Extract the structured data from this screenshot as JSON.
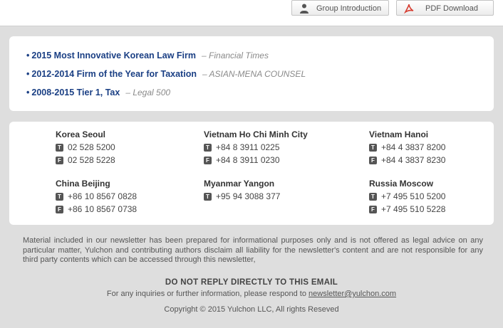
{
  "header": {
    "group_intro_label": "Group Introduction",
    "pdf_label": "PDF Download"
  },
  "awards": [
    {
      "title": "2015 Most Innovative Korean Law Firm",
      "source": "– Financial Times"
    },
    {
      "title": "2012-2014 Firm of the Year for Taxation",
      "source": "– ASIAN-MENA COUNSEL"
    },
    {
      "title": "2008-2015 Tier 1, Tax",
      "source": "– Legal 500"
    }
  ],
  "offices": [
    {
      "name": "Korea Seoul",
      "tel": "02 528 5200",
      "fax": "02 528 5228"
    },
    {
      "name": "Vietnam Ho Chi Minh City",
      "tel": "+84 8 3911 0225",
      "fax": "+84 8 3911 0230"
    },
    {
      "name": "Vietnam Hanoi",
      "tel": "+84 4 3837 8200",
      "fax": "+84 4 3837 8230"
    },
    {
      "name": "China Beijing",
      "tel": "+86 10 8567 0828",
      "fax": "+86 10 8567 0738"
    },
    {
      "name": "Myanmar Yangon",
      "tel": "+95 94 3088 377"
    },
    {
      "name": "Russia Moscow",
      "tel": "+7 495 510 5200",
      "fax": "+7 495 510 5228"
    }
  ],
  "badges": {
    "tel": "T",
    "fax": "F"
  },
  "footer": {
    "disclaimer": "Material included in our newsletter has been prepared for informational purposes only and is not offered as legal advice on any particular matter, Yulchon and contributing authors disclaim all liability for the newsletter's content and are not responsible for any third party contents which can be accessed through this newsletter,",
    "no_reply": "DO NOT REPLY DIRECTLY TO THIS EMAIL",
    "inquiry_text": "For any inquiries or further information, please respond to ",
    "email": "newsletter@yulchon.com",
    "copyright": "Copyright © 2015 Yulchon LLC, All rights Reseved"
  },
  "colors": {
    "accent": "#1a3f84",
    "background": "#dedede",
    "panel": "#ffffff"
  }
}
